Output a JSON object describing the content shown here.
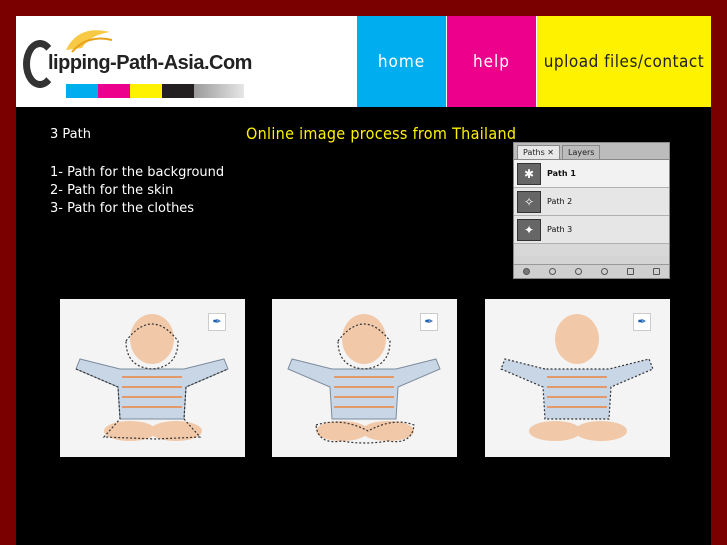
{
  "logo": {
    "text": "lipping-Path-Asia.Com",
    "colors": [
      "#00aeef",
      "#ec008c",
      "#fff200",
      "#231f20"
    ]
  },
  "nav": {
    "home": "home",
    "help": "help",
    "upload": "upload files/contact"
  },
  "content": {
    "heading": "3 Path",
    "items": [
      "1- Path for the background",
      "2- Path for the skin",
      "3- Path for the clothes"
    ],
    "tagline": "Online image process from Thailand"
  },
  "panel": {
    "tabs": [
      "Paths",
      "Layers"
    ],
    "paths": [
      "Path 1",
      "Path 2",
      "Path 3"
    ]
  },
  "photos": [
    {
      "pen_icon": "pen-tool-icon"
    },
    {
      "pen_icon": "pen-tool-icon"
    },
    {
      "pen_icon": "pen-tool-icon"
    }
  ]
}
